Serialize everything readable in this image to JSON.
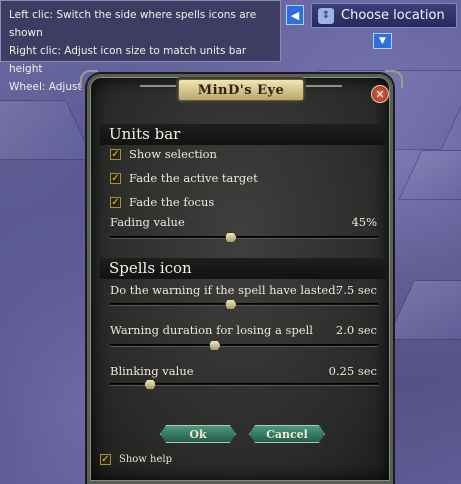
{
  "tooltip": {
    "lines": [
      "Left clic: Switch the side where spells icons are shown",
      "Right clic: Adjust icon size to match units bar height",
      "Wheel: Adjust icon size"
    ]
  },
  "location": {
    "label": "Choose location"
  },
  "window": {
    "title": "MinD's Eye",
    "units_bar": {
      "heading": "Units bar",
      "checks": [
        {
          "label": "Show selection",
          "checked": true
        },
        {
          "label": "Fade the active target",
          "checked": true
        },
        {
          "label": "Fade the focus",
          "checked": true
        }
      ],
      "fading": {
        "label": "Fading value",
        "value": "45%",
        "level": 0.45
      }
    },
    "spells_icon": {
      "heading": "Spells icon",
      "warning": {
        "label": "Do the warning if the spell have lasted:",
        "value": "7.5 sec",
        "level": 0.45
      },
      "duration": {
        "label": "Warning duration for losing a spell",
        "value": "2.0 sec",
        "level": 0.39
      },
      "blinking": {
        "label": "Blinking value",
        "value": "0.25 sec",
        "level": 0.15
      }
    },
    "ok_label": "Ok",
    "cancel_label": "Cancel",
    "show_help": {
      "label": "Show help",
      "checked": true
    }
  },
  "colors": {
    "accent_gold": "#d1c28a",
    "button_green": "#2f7a62",
    "location_blue": "#2f6fd8"
  }
}
